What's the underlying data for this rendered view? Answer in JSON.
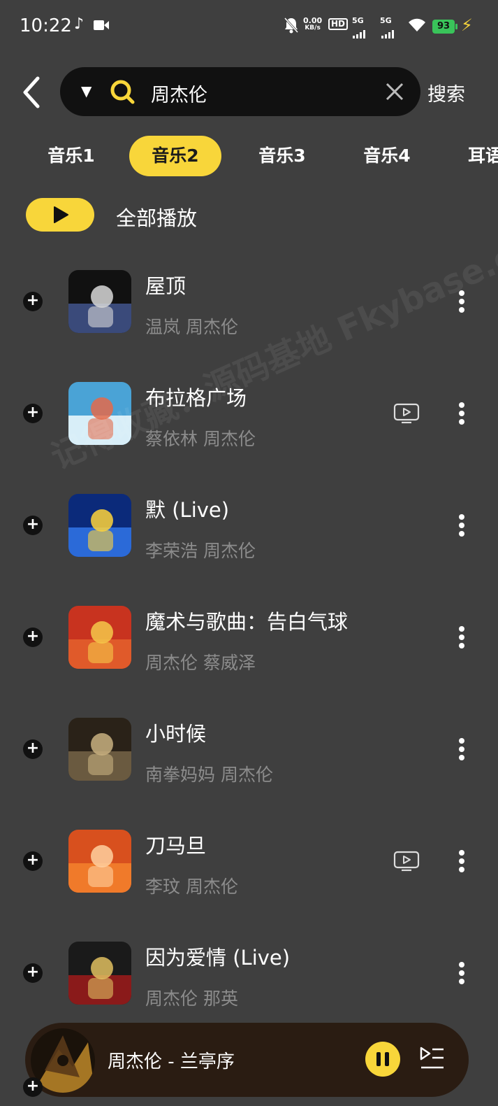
{
  "status_bar": {
    "time": "10:22",
    "net_speed_value": "0.00",
    "net_speed_unit": "KB/s",
    "hd_label": "HD",
    "sim1_label": "5G",
    "sim2_label": "5G",
    "battery": "93",
    "icons": [
      "music-note-icon",
      "video-camera-icon",
      "mute-bell-icon",
      "wifi-icon",
      "charging-bolt-icon"
    ]
  },
  "search": {
    "query": "周杰伦",
    "button_label": "搜索"
  },
  "tabs": [
    {
      "label": "音乐1",
      "active": false
    },
    {
      "label": "音乐2",
      "active": true
    },
    {
      "label": "音乐3",
      "active": false
    },
    {
      "label": "音乐4",
      "active": false
    },
    {
      "label": "耳语",
      "active": false
    }
  ],
  "play_all": {
    "label": "全部播放"
  },
  "songs": [
    {
      "title": "屋顶",
      "artist": "温岚 周杰伦",
      "has_mv": false,
      "cover_colors": [
        "#111111",
        "#3a4a7a",
        "#d8d8d8"
      ]
    },
    {
      "title": "布拉格广场",
      "artist": "蔡依林 周杰伦",
      "has_mv": true,
      "cover_colors": [
        "#4aa3d6",
        "#d8eef8",
        "#e46a4a"
      ]
    },
    {
      "title": "默 (Live)",
      "artist": "李荣浩 周杰伦",
      "has_mv": false,
      "cover_colors": [
        "#0b2a7a",
        "#2b6ad8",
        "#ffd43a"
      ]
    },
    {
      "title": "魔术与歌曲：告白气球",
      "artist": "周杰伦 蔡威泽",
      "has_mv": false,
      "cover_colors": [
        "#c8331f",
        "#e05a2a",
        "#f5c84a"
      ]
    },
    {
      "title": "小时候",
      "artist": "南拳妈妈 周杰伦",
      "has_mv": false,
      "cover_colors": [
        "#2a2218",
        "#6a5a40",
        "#c8b080"
      ]
    },
    {
      "title": "刀马旦",
      "artist": "李玟 周杰伦",
      "has_mv": true,
      "cover_colors": [
        "#d8501e",
        "#f07a2a",
        "#ffd0a0"
      ]
    },
    {
      "title": "因为爱情 (Live)",
      "artist": "周杰伦 那英",
      "has_mv": false,
      "cover_colors": [
        "#1a1a1a",
        "#8a1a1a",
        "#e0c060"
      ]
    }
  ],
  "watermark": "记得收藏：源码基地 Fkybase.com",
  "player": {
    "title": "周杰伦 - 兰亭序",
    "cover_colors": [
      "#1a120a",
      "#c8902a",
      "#5a3a18"
    ]
  },
  "colors": {
    "accent": "#f8d63a",
    "background": "#3f3f3f",
    "secondary_text": "#8c8c8c"
  }
}
